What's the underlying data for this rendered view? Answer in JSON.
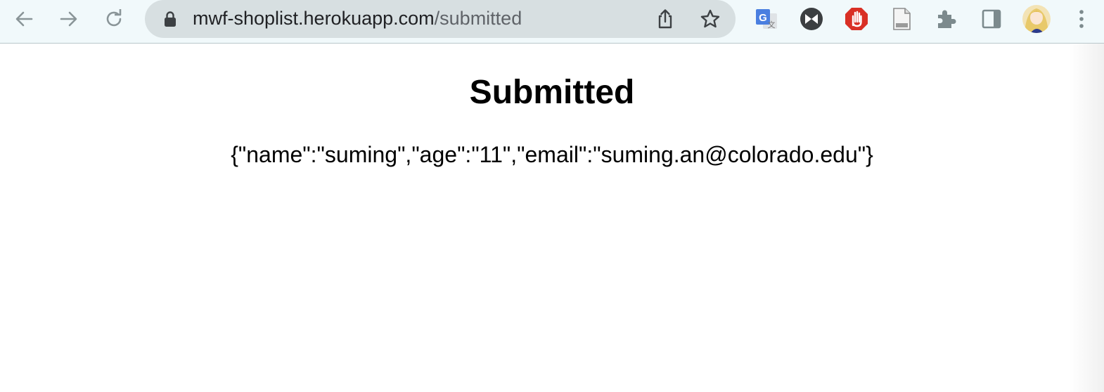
{
  "browser": {
    "url_host": "mwf-shoplist.herokuapp.com",
    "url_path": "/submitted",
    "extensions": [
      "google-translate-icon",
      "bowtie-extension-icon",
      "adblock-icon",
      "document-icon"
    ],
    "colors": {
      "toolbar_bg": "#f1f9fb",
      "omnibox_bg": "#d7dfe1",
      "icon_gray": "#7c8a8d",
      "adblock_red": "#d93025",
      "translate_blue": "#4a7fe0"
    }
  },
  "page": {
    "title": "Submitted",
    "submitted_json": "{\"name\":\"suming\",\"age\":\"11\",\"email\":\"suming.an@colorado.edu\"}"
  }
}
